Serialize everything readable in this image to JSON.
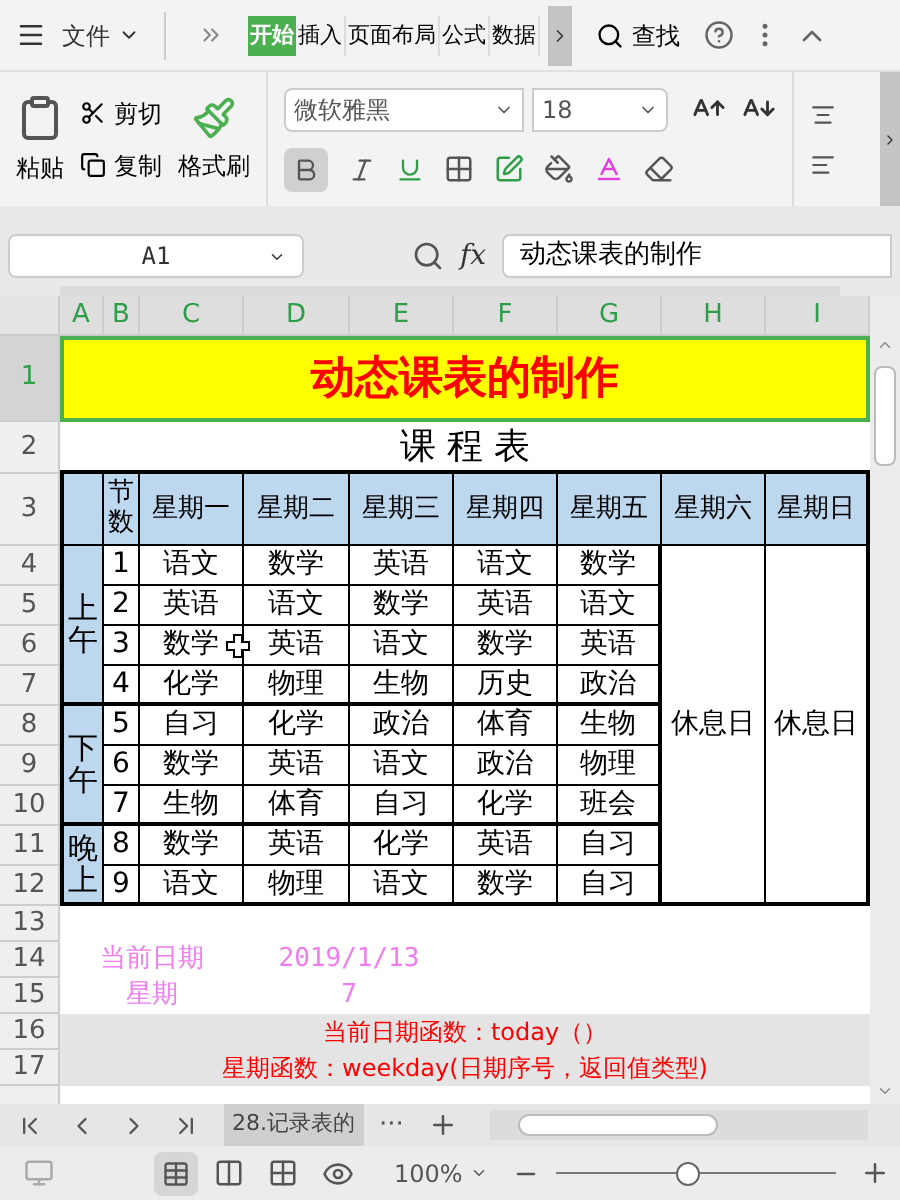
{
  "menu": {
    "file": "文件",
    "tabs": [
      {
        "label": "开始",
        "selected": true
      },
      {
        "label": "插入",
        "selected": false
      },
      {
        "label": "页面布局",
        "selected": false
      },
      {
        "label": "公式",
        "selected": false
      },
      {
        "label": "数据",
        "selected": false
      }
    ],
    "search": "查找"
  },
  "ribbon": {
    "paste": "粘贴",
    "cut": "剪切",
    "copy": "复制",
    "format_painter": "格式刷",
    "font": "微软雅黑",
    "size": "18",
    "bold": true
  },
  "formula_bar": {
    "cell": "A1",
    "fx": "fx",
    "value": "动态课表的制作"
  },
  "columns": [
    {
      "label": "A",
      "selected": true
    },
    {
      "label": "B",
      "selected": true
    },
    {
      "label": "C",
      "selected": true
    },
    {
      "label": "D",
      "selected": true
    },
    {
      "label": "E",
      "selected": true
    },
    {
      "label": "F",
      "selected": true
    },
    {
      "label": "G",
      "selected": true
    },
    {
      "label": "H",
      "selected": true
    },
    {
      "label": "I",
      "selected": true
    }
  ],
  "rows": [
    {
      "label": "1",
      "selected": true
    },
    {
      "label": "2",
      "selected": false
    },
    {
      "label": "3",
      "selected": false
    },
    {
      "label": "4",
      "selected": false
    },
    {
      "label": "5",
      "selected": false
    },
    {
      "label": "6",
      "selected": false
    },
    {
      "label": "7",
      "selected": false
    },
    {
      "label": "8",
      "selected": false
    },
    {
      "label": "9",
      "selected": false
    },
    {
      "label": "10",
      "selected": false
    },
    {
      "label": "11",
      "selected": false
    },
    {
      "label": "12",
      "selected": false
    },
    {
      "label": "13",
      "selected": false
    },
    {
      "label": "14",
      "selected": false
    },
    {
      "label": "15",
      "selected": false
    },
    {
      "label": "16",
      "selected": false
    },
    {
      "label": "17",
      "selected": false
    }
  ],
  "sheet": {
    "title": {
      "text": "动态课表的制作",
      "selected": true
    },
    "subtitle": "课 程 表",
    "headers": [
      "节数",
      "星期一",
      "星期二",
      "星期三",
      "星期四",
      "星期五",
      "星期六",
      "星期日"
    ],
    "periods": [
      {
        "label": "上午",
        "lessons": [
          {
            "no": "1",
            "classes": [
              "语文",
              "数学",
              "英语",
              "语文",
              "数学"
            ]
          },
          {
            "no": "2",
            "classes": [
              "英语",
              "语文",
              "数学",
              "英语",
              "语文"
            ]
          },
          {
            "no": "3",
            "classes": [
              "数学",
              "英语",
              "语文",
              "数学",
              "英语"
            ]
          },
          {
            "no": "4",
            "classes": [
              "化学",
              "物理",
              "生物",
              "历史",
              "政治"
            ]
          }
        ]
      },
      {
        "label": "下午",
        "lessons": [
          {
            "no": "5",
            "classes": [
              "自习",
              "化学",
              "政治",
              "体育",
              "生物"
            ]
          },
          {
            "no": "6",
            "classes": [
              "数学",
              "英语",
              "语文",
              "政治",
              "物理"
            ]
          },
          {
            "no": "7",
            "classes": [
              "生物",
              "体育",
              "自习",
              "化学",
              "班会"
            ]
          }
        ]
      },
      {
        "label": "晚上",
        "lessons": [
          {
            "no": "8",
            "classes": [
              "数学",
              "英语",
              "化学",
              "英语",
              "自习"
            ]
          },
          {
            "no": "9",
            "classes": [
              "语文",
              "物理",
              "语文",
              "数学",
              "自习"
            ]
          }
        ]
      }
    ],
    "rest": [
      "休息日",
      "休息日"
    ],
    "date_label": "当前日期",
    "date_value": "2019/1/13",
    "weekday_label": "星期",
    "weekday_value": "7",
    "notes": [
      "当前日期函数：today（）",
      "星期函数：weekday(日期序号，返回值类型)"
    ]
  },
  "sheet_tab": "28.记录表的",
  "more": "···",
  "zoom": {
    "value": "100%",
    "level": 0.47
  }
}
